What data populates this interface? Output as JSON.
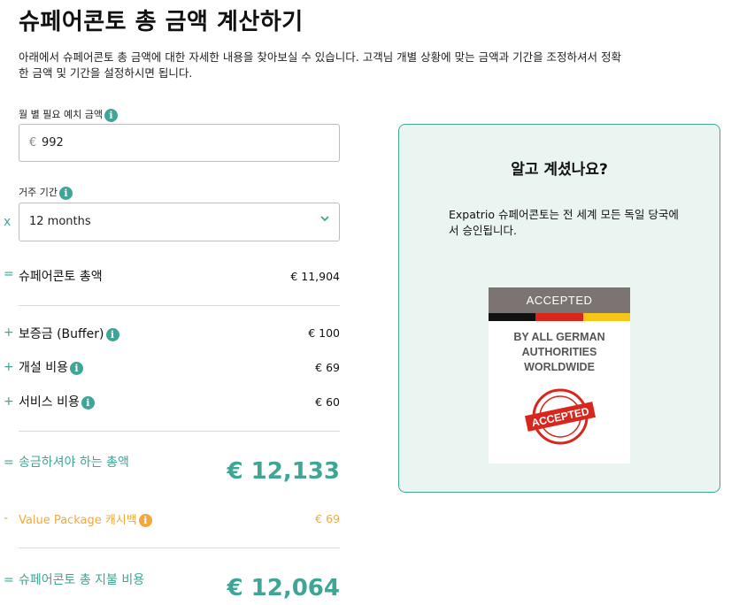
{
  "page": {
    "title": "슈페어콘토 총 금액 계산하기",
    "description_line1": "아래에서 슈페어콘토 총 금액에 대한 자세한 내용을 찾아보실 수 있습니다. 고객님 개별 상황에 맞는 금액과 기간을 조정하셔서 정확",
    "description_line2": "한 금액 및 기간을 설정하시면 됩니다."
  },
  "form": {
    "deposit_label": "월 별 필요 예치 금액",
    "deposit_currency": "€",
    "deposit_value": "992",
    "duration_label": "거주 기간",
    "duration_operator": "x",
    "duration_value": "12 months"
  },
  "breakdown": {
    "total": {
      "op": "=",
      "label": "슈페어콘토 총액",
      "amount": "€ 11,904"
    },
    "buffer": {
      "op": "+",
      "label": "보증금 (Buffer)",
      "amount": "€ 100"
    },
    "opening": {
      "op": "+",
      "label": "개설 비용",
      "amount": "€ 69"
    },
    "service": {
      "op": "+",
      "label": "서비스 비용",
      "amount": "€ 60"
    },
    "transfer": {
      "op": "=",
      "label": "송금하셔야 하는 총액",
      "amount": "€ 12,133"
    },
    "cashback": {
      "op": "-",
      "label": "Value Package 캐시백",
      "amount": "€ 69"
    },
    "final": {
      "op": "=",
      "label": "슈페어콘토 총 지불 비용",
      "amount": "€ 12,064"
    }
  },
  "info_card": {
    "title": "알고 계셨나요?",
    "text": "Expatrio 슈페어콘토는 전 세계 모든 독일 당국에서 승인됩니다.",
    "badge_top": "ACCEPTED",
    "badge_line1": "BY ALL GERMAN",
    "badge_line2": "AUTHORITIES",
    "badge_line3": "WORLDWIDE",
    "stamp_text": "ACCEPTED"
  },
  "colors": {
    "accent": "#3fa596",
    "cashback": "#f0a93a",
    "card_bg": "#eaf5f2"
  },
  "icons": [
    "info-icon",
    "chevron-down-icon"
  ]
}
